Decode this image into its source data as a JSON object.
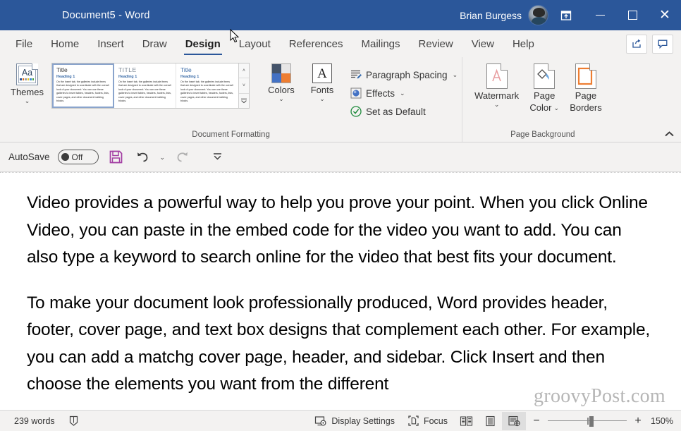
{
  "titlebar": {
    "document_title": "Document5  -  Word",
    "user_name": "Brian Burgess",
    "ribbon_display_icon": "ribbon-display-options-icon",
    "minimize_label": "Minimize",
    "restore_label": "Restore Down",
    "close_label": "Close"
  },
  "tabs": [
    {
      "label": "File",
      "active": false
    },
    {
      "label": "Home",
      "active": false
    },
    {
      "label": "Insert",
      "active": false
    },
    {
      "label": "Draw",
      "active": false
    },
    {
      "label": "Design",
      "active": true
    },
    {
      "label": "Layout",
      "active": false
    },
    {
      "label": "References",
      "active": false
    },
    {
      "label": "Mailings",
      "active": false
    },
    {
      "label": "Review",
      "active": false
    },
    {
      "label": "View",
      "active": false
    },
    {
      "label": "Help",
      "active": false
    }
  ],
  "tabs_right": {
    "share_label": "Share",
    "comments_label": "Comments"
  },
  "ribbon": {
    "groups": [
      {
        "label": "Document Formatting"
      },
      {
        "label": "Page Background"
      }
    ],
    "themes": {
      "label": "Themes",
      "chevron": "⌄"
    },
    "gallery": {
      "thumbs": [
        {
          "title": "Title",
          "heading": "Heading 1",
          "body": "On the Insert tab, the galleries include items that are designed to coordinate with the overall look of your document. You can use these galleries to insert tables, headers, footers, lists, cover pages, and other document building blocks.",
          "style": "plain",
          "selected": true
        },
        {
          "title": "TITLE",
          "heading": "Heading 1",
          "body": "On the Insert tab, the galleries include items that are designed to coordinate with the overall look of your document. You can use these galleries to insert tables, headers, footers, lists, cover pages, and other document building blocks.",
          "style": "caps",
          "selected": false
        },
        {
          "title": "Title",
          "heading": "Heading 1",
          "body": "On the Insert tab, the galleries include items that are designed to coordinate with the overall look of your document. You can use these galleries to insert tables, headers, footers, lists, cover pages, and other document building blocks.",
          "style": "blue",
          "selected": false
        }
      ],
      "scroll_up": "˄",
      "scroll_down": "˅",
      "more": "≣"
    },
    "colors": {
      "label": "Colors",
      "chevron": "⌄",
      "swatches": [
        "#44546a",
        "#e7e6e6",
        "#4472c4",
        "#ed7d31"
      ]
    },
    "fonts": {
      "label": "Fonts",
      "chevron": "⌄",
      "sample": "A"
    },
    "paragraph_spacing": {
      "label": "Paragraph Spacing",
      "chevron": "⌄"
    },
    "effects": {
      "label": "Effects",
      "chevron": "⌄"
    },
    "set_as_default": {
      "label": "Set as Default"
    },
    "watermark": {
      "label": "Watermark",
      "chevron": "⌄"
    },
    "page_color": {
      "label_line1": "Page",
      "label_line2": "Color",
      "chevron": "⌄"
    },
    "page_borders": {
      "label_line1": "Page",
      "label_line2": "Borders"
    },
    "collapse": {
      "label": "Collapse the Ribbon",
      "glyph": "⌃"
    }
  },
  "qat": {
    "autosave_label": "AutoSave",
    "autosave_state": "Off",
    "save_label": "Save",
    "undo_label": "Undo",
    "undo_chevron": "⌄",
    "redo_label": "Redo",
    "customize_label": "Customize Quick Access Toolbar"
  },
  "document": {
    "paragraphs": [
      "Video provides a powerful way to help you prove your point. When you click Online Video, you can paste in the embed code for the video you want to add. You can also type a keyword to search online for the video that best fits your document.",
      "To make your document look professionally produced, Word provides header, footer, cover page, and text box designs that complement each other. For example, you can add a matchg cover page, header, and sidebar. Click Insert and then choose the elements you want from the different"
    ],
    "watermark": "groovyPost.com"
  },
  "statusbar": {
    "word_count": "239 words",
    "proofing_icon": "proofing-errors-icon",
    "display_settings": "Display Settings",
    "focus": "Focus",
    "view_read": "Read Mode",
    "view_print": "Print Layout",
    "view_web": "Web Layout",
    "zoom_out": "−",
    "zoom_in": "+",
    "zoom_value": "150%"
  },
  "colors": {
    "title_bar": "#2b579a",
    "accent": "#2b579a",
    "ribbon_bg": "#f3f2f1",
    "save_icon": "#a33ea3",
    "page_borders_accent": "#ed7d31",
    "watermark_text": "#b6b6b6"
  }
}
